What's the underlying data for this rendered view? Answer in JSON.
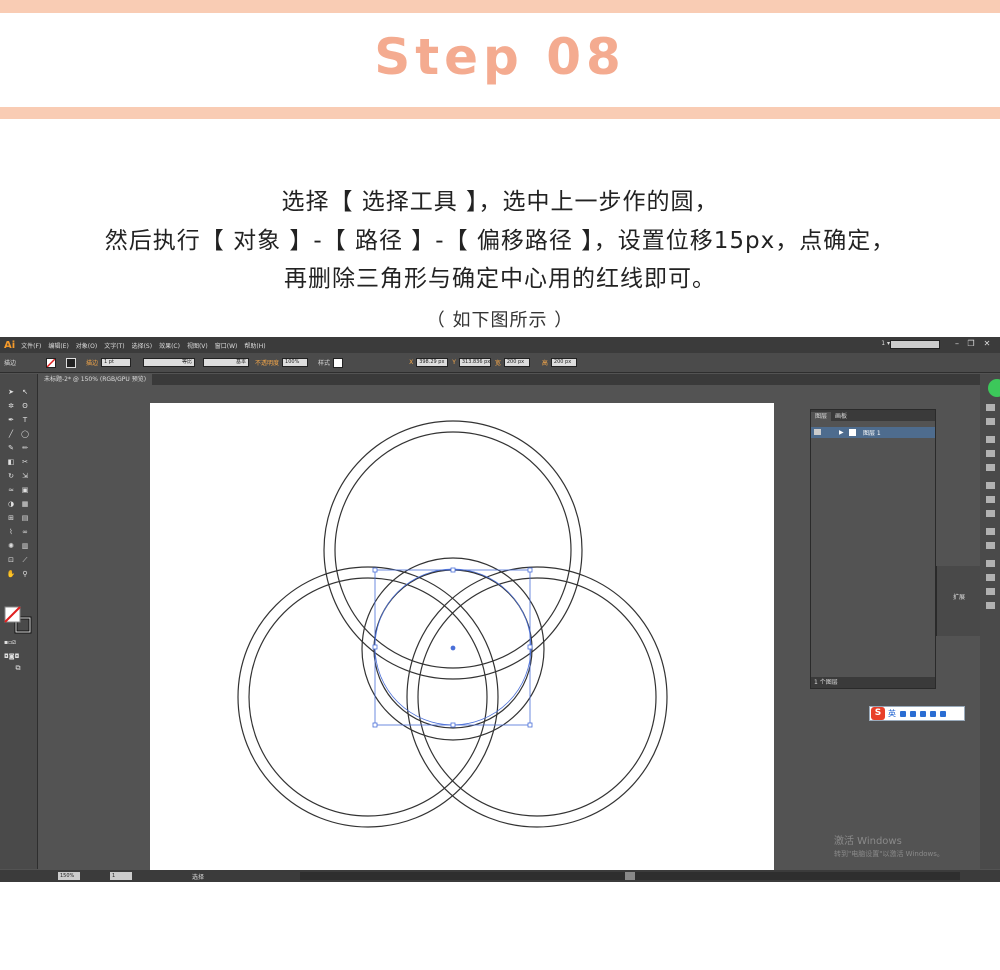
{
  "header": {
    "title": "Step 08"
  },
  "instructions": {
    "line1": "选择【 选择工具 】，选中上一步作的圆，",
    "line2": "然后执行【 对象 】-【 路径 】-【 偏移路径 】，设置位移15px，点确定，",
    "line3": "再删除三角形与确定中心用的红线即可。"
  },
  "caption": "（ 如下图所示 ）",
  "colors": {
    "accent": "#f4ab90",
    "band": "#f9ccb4",
    "ui_dark": "#535353",
    "selection": "#4a6fd8"
  },
  "ai_window": {
    "logo": "Ai",
    "menus": [
      "文件(F)",
      "编辑(E)",
      "对象(O)",
      "文字(T)",
      "选择(S)",
      "效果(C)",
      "视图(V)",
      "窗口(W)",
      "帮助(H)"
    ],
    "workspace": "1 ▾",
    "control_bar": {
      "label": "描边",
      "stroke_label": "描边",
      "stroke_width": "1 pt",
      "profile": "等比",
      "brush": "基本",
      "opacity_label": "不透明度",
      "opacity": "100%",
      "style_label": "样式",
      "x": "398.29 px",
      "y": "313.836 px",
      "w": "200 px",
      "h": "200 px"
    },
    "doc_tab": "未标题-2* @ 150% (RGB/GPU 预览)",
    "layers_panel": {
      "tabs": [
        "图层",
        "画板"
      ],
      "layer_name": "图层 1",
      "footer": "1 个图层"
    },
    "expand_label": "扩展",
    "ime": {
      "brand": "S",
      "mode": "英"
    },
    "watermark": {
      "line1": "激活 Windows",
      "line2": "转到\"电脑设置\"以激活 Windows。"
    },
    "status": {
      "zoom": "150%",
      "page": "1",
      "tool": "选择"
    }
  }
}
